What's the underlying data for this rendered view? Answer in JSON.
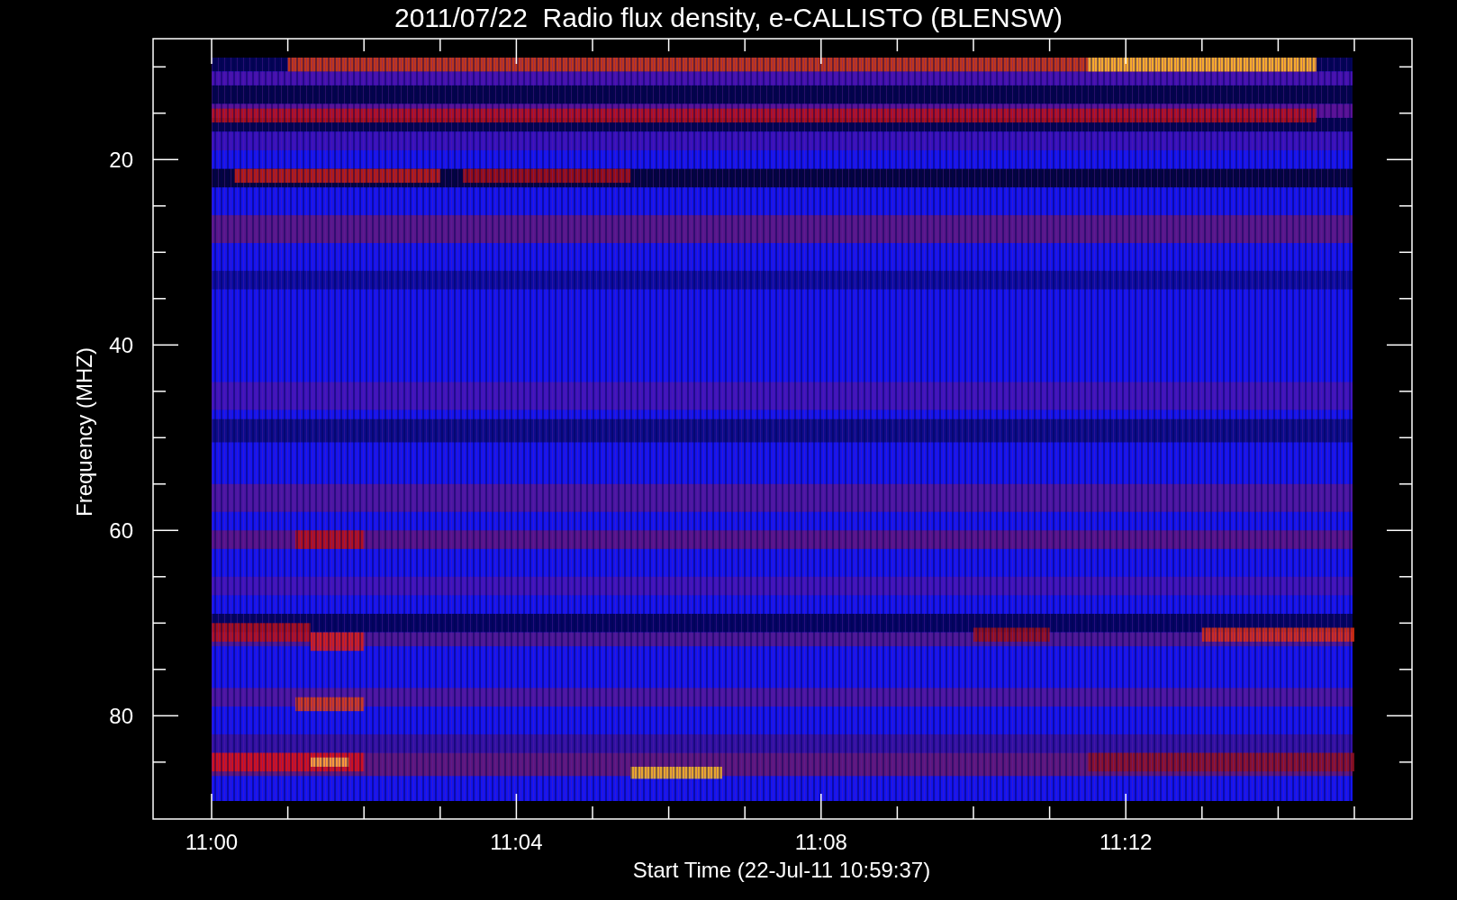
{
  "plot": {
    "title": "2011/07/22  Radio flux density, e-CALLISTO (BLENSW)",
    "ylabel": "Frequency (MHZ)",
    "xlabel": "Start Time (22-Jul-11 10:59:37)",
    "yticks": [
      "20",
      "40",
      "60",
      "80"
    ],
    "xticks": [
      "11:00",
      "11:04",
      "11:08",
      "11:12"
    ]
  }
}
